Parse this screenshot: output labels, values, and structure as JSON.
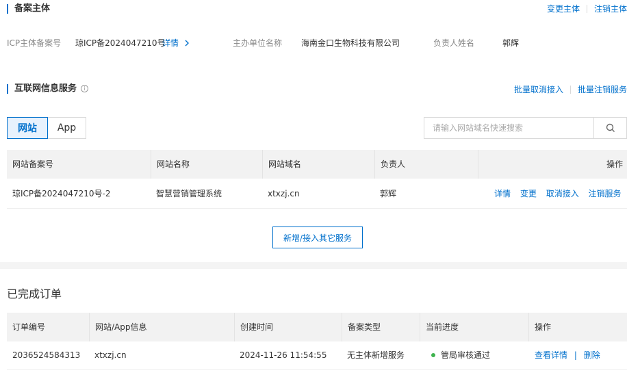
{
  "beian": {
    "title": "备案主体",
    "change_link": "变更主体",
    "cancel_link": "注销主体",
    "icp_label": "ICP主体备案号",
    "icp_value": "琼ICP备2024047210号",
    "detail_link": "详情",
    "org_label": "主办单位名称",
    "org_value": "海南金口生物科技有限公司",
    "person_label": "负责人姓名",
    "person_value": "郭辉"
  },
  "services": {
    "title": "互联网信息服务",
    "batch_unlink": "批量取消接入",
    "batch_cancel": "批量注销服务",
    "tabs": [
      "网站",
      "App"
    ],
    "search_placeholder": "请输入网站域名快速搜索",
    "columns": [
      "网站备案号",
      "网站名称",
      "网站域名",
      "负责人",
      "操作"
    ],
    "rows": [
      {
        "record": "琼ICP备2024047210号-2",
        "name": "智慧营销管理系统",
        "domain": "xtxzj.cn",
        "person": "郭辉",
        "actions": [
          "详情",
          "变更",
          "取消接入",
          "注销服务"
        ]
      }
    ],
    "add_button": "新增/接入其它服务"
  },
  "orders": {
    "title": "已完成订单",
    "columns": [
      "订单编号",
      "网站/App信息",
      "创建时间",
      "备案类型",
      "当前进度",
      "操作"
    ],
    "rows": [
      {
        "id": "2036524584313",
        "info": "xtxzj.cn",
        "created": "2024-11-26 11:54:55",
        "type": "无主体新增服务",
        "status": "管局审核通过",
        "actions": [
          "查看详情",
          "删除"
        ]
      }
    ],
    "status_color": "#3fb34f"
  },
  "colors": {
    "accent": "#0070cc",
    "header_bg": "#f2f2f2"
  },
  "icons": {
    "search": "search-icon",
    "info": "info-icon",
    "chevron": "chevron-right-icon"
  }
}
